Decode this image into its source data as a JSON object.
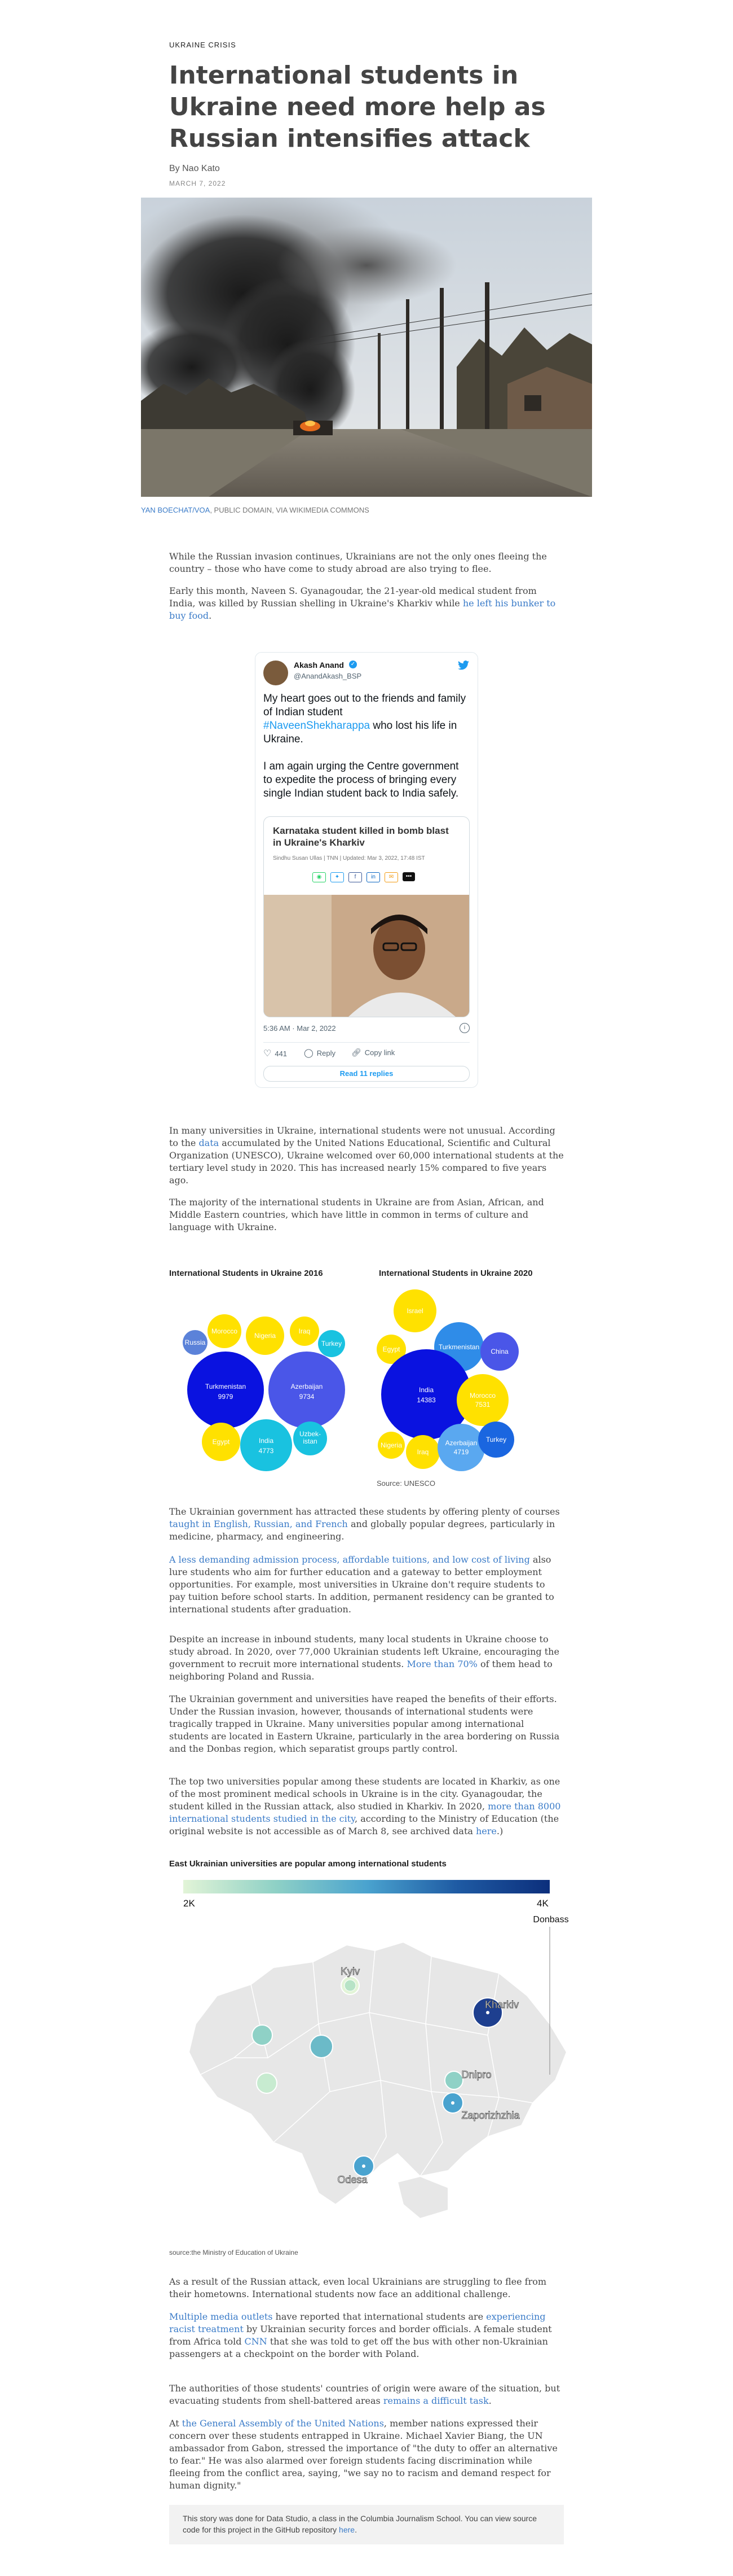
{
  "article": {
    "kicker": "UKRAINE CRISIS",
    "title": "International students in Ukraine need more help as Russian intensifies attack",
    "byline": "By Nao Kato",
    "date": "MARCH 7, 2022",
    "photo_credit_link": "YAN BOECHAT/VOA",
    "photo_credit_rest": ", PUBLIC DOMAIN, VIA WIKIMEDIA COMMONS"
  },
  "paragraphs": {
    "p1": "While the Russian invasion continues, Ukrainians are not the only ones fleeing the country – those who have come to study abroad are also trying to flee.",
    "p2_a": "Early this month, Naveen S. Gyanagoudar, the 21-year-old medical student from India, was killed by Russian shelling in Ukraine's Kharkiv while ",
    "p2_link": "he left his bunker to buy food",
    "p2_b": ".",
    "p3_a": "In many universities in Ukraine, international students were not unusual. According to the ",
    "p3_link": "data",
    "p3_b": " accumulated by the United Nations Educational, Scientific and Cultural Organization (UNESCO), Ukraine welcomed over 60,000 international students at the tertiary level study in 2020. This has increased nearly 15% compared to five years ago.",
    "p4": "The majority of the international students in Ukraine are from Asian, African, and Middle Eastern countries, which have little in common in terms of culture and language with Ukraine.",
    "p5_a": "The Ukrainian government has attracted these students by offering plenty of courses ",
    "p5_link": "taught in English, Russian, and French",
    "p5_b": " and globally popular degrees, particularly in medicine, pharmacy, and engineering.",
    "p6_link": "A less demanding admission process, affordable tuitions, and low cost of living",
    "p6_b": " also lure students who aim for further education and a gateway to better employment opportunities. For example, most universities in Ukraine don't require students to pay tuition before school starts. In addition, permanent residency can be granted to international students after graduation.",
    "p7_a": "Despite an increase in inbound students, many local students in Ukraine choose to study abroad. In 2020, over 77,000 Ukrainian students left Ukraine, encouraging the government to recruit more international students. ",
    "p7_link": "More than 70%",
    "p7_b": " of them head to neighboring Poland and Russia.",
    "p8": "The Ukrainian government and universities have reaped the benefits of their efforts. Under the Russian invasion, however, thousands of international students were tragically trapped in Ukraine. Many universities popular among international students are located in Eastern Ukraine, particularly in the area bordering on Russia and the Donbas region, which separatist groups partly control.",
    "p9_a": "The top two universities popular among these students are located in Kharkiv, as one of the most prominent medical schools in Ukraine is in the city. Gyanagoudar, the student killed in the Russian attack, also studied in Kharkiv. In 2020, ",
    "p9_link": "more than 8000 international students studied in the city",
    "p9_b": ", according to the Ministry of Education (the original website is not accessible as of March 8, see archived data ",
    "p9_link2": "here",
    "p9_c": ".)",
    "p10": "As a result of the Russian attack, even local Ukrainians are struggling to flee from their hometowns. International students now face an additional challenge.",
    "p11_link": "Multiple media outlets",
    "p11_b": " have reported that international students are ",
    "p11_link2": "experiencing racist treatment",
    "p11_c": " by Ukrainian security forces and border officials. A female student from Africa told ",
    "p11_link3": "CNN",
    "p11_d": " that she was told to get off the bus with other non-Ukrainian passengers at a checkpoint on the border with Poland.",
    "p12_a": "The authorities of those students' countries of origin were aware of the situation, but evacuating students from shell-battered areas ",
    "p12_link": "remains a difficult task",
    "p12_b": ".",
    "p13_a": "At ",
    "p13_link": "the General Assembly of the United Nations",
    "p13_b": ", member nations expressed their concern over these students entrapped in Ukraine. Michael Xavier Biang, the UN ambassador from Gabon, stressed the importance of \"the duty to offer an alternative to fear.\" He was also alarmed over foreign students facing discrimination while fleeing from the conflict area, saying, \"we say no to racism and demand respect for human dignity.\""
  },
  "tweet": {
    "name": "Akash Anand",
    "handle": "@AnandAkash_BSP",
    "text_1": "My heart goes out to the friends and family of Indian student",
    "hashtag": "#NaveenShekharappa",
    "text_2": " who lost his life in Ukraine.",
    "text_3": "I am again urging the Centre government to expedite the process of bringing every single Indian student back to India safely.",
    "card_title": "Karnataka student killed in bomb blast in Ukraine's Kharkiv",
    "card_meta": "Sindhu Susan Ullas | TNN | Updated: Mar 3, 2022, 17:48 IST",
    "timestamp": "5:36 AM · Mar 2, 2022",
    "likes": "441",
    "reply_label": "Reply",
    "copy_label": "Copy link",
    "read_replies": "Read 11 replies"
  },
  "bubble_charts": {
    "chart1_title": "International Students in Ukraine 2016",
    "chart2_title": "International Students in Ukraine 2020",
    "source": "Source: UNESCO",
    "colors": {
      "blue_dark": "#0a12e0",
      "blue_mid": "#4a56e8",
      "yellow": "#ffe100",
      "cyan": "#19c2e0"
    }
  },
  "chart_data": [
    {
      "type": "bubble",
      "title": "International Students in Ukraine 2016",
      "series": [
        {
          "name": "Turkmenistan",
          "value": 9979
        },
        {
          "name": "Azerbaijan",
          "value": 9734
        },
        {
          "name": "India",
          "value": 4773
        },
        {
          "name": "Morocco"
        },
        {
          "name": "Nigeria"
        },
        {
          "name": "Iraq"
        },
        {
          "name": "Russia"
        },
        {
          "name": "Turkey"
        },
        {
          "name": "Egypt"
        },
        {
          "name": "Uzbekistan"
        }
      ]
    },
    {
      "type": "bubble",
      "title": "International Students in Ukraine 2020",
      "series": [
        {
          "name": "India",
          "value": 14383
        },
        {
          "name": "Morocco",
          "value": 7531
        },
        {
          "name": "Azerbaijan",
          "value": 4719
        },
        {
          "name": "Turkmenistan"
        },
        {
          "name": "China"
        },
        {
          "name": "Nigeria"
        },
        {
          "name": "Turkey"
        },
        {
          "name": "Israel"
        },
        {
          "name": "Egypt"
        },
        {
          "name": "Iraq"
        }
      ]
    },
    {
      "type": "map",
      "title": "East Ukrainian universities are popular among international students",
      "legend_min": "2K",
      "legend_max": "4K",
      "cities": [
        "Kyiv",
        "Kharkiv",
        "Dnipro",
        "Zaporizhzhia",
        "Odesa"
      ],
      "region_label": "Donbass",
      "source": "source:the Ministry of Education of Ukraine"
    }
  ],
  "map_section": {
    "title": "East Ukrainian universities are popular among international students",
    "legend_min": "2K",
    "legend_max": "4K",
    "donbass": "Donbass",
    "kyiv": "Kyiv",
    "kharkiv": "Kharkiv",
    "dnipro": "Dnipro",
    "zaporizhzhia": "Zaporizhzhia",
    "odesa": "Odesa",
    "source": "source:the Ministry of Education of Ukraine"
  },
  "footer_note": {
    "text_a": "This story was done for Data Studio, a class in the Columbia Journalism School. You can view source code for this project in the GitHub repository ",
    "link": "here",
    "text_b": "."
  }
}
